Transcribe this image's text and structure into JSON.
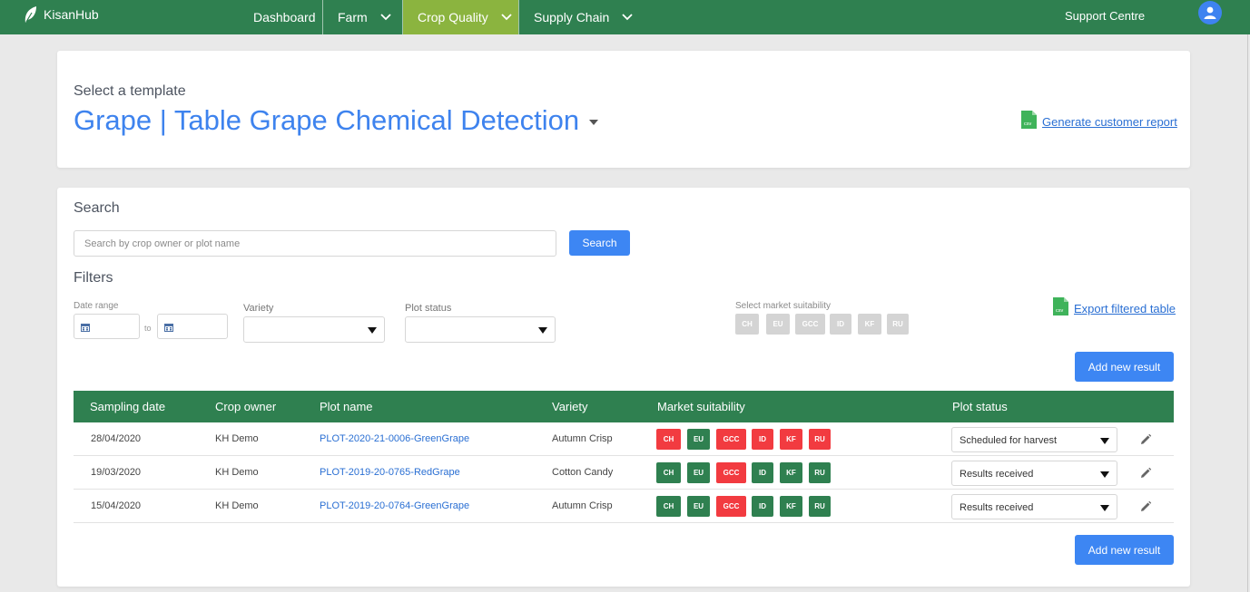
{
  "app": {
    "brand": "KisanHub",
    "nav": [
      {
        "label": "Dashboard",
        "has_menu": false,
        "active": false
      },
      {
        "label": "Farm",
        "has_menu": true,
        "active": false
      },
      {
        "label": "Crop Quality",
        "has_menu": true,
        "active": true
      },
      {
        "label": "Supply Chain",
        "has_menu": true,
        "active": false
      }
    ],
    "support_label": "Support Centre",
    "avatar_icon": "user-icon"
  },
  "template": {
    "label": "Select a template",
    "selected": "Grape | Table Grape Chemical Detection",
    "report_link": "Generate customer report",
    "report_icon": "csv-file-icon",
    "csv_badge": "csv"
  },
  "search": {
    "heading": "Search",
    "placeholder": "Search by crop owner or plot name",
    "value": "",
    "button": "Search"
  },
  "filters": {
    "heading": "Filters",
    "date_range_label": "Date range",
    "to_label": "to",
    "date_from": "",
    "date_to": "",
    "variety_label": "Variety",
    "variety_value": "",
    "plot_status_label": "Plot status",
    "plot_status_value": "",
    "market_label": "Select market suitability",
    "markets": [
      "CH",
      "EU",
      "GCC",
      "ID",
      "KF",
      "RU"
    ],
    "export_link": "Export filtered table",
    "add_result": "Add new result"
  },
  "colors": {
    "brand_green": "#2f8050",
    "active_nav": "#8bb43f",
    "accent_blue": "#3d86f3",
    "suitable": "#2f8050",
    "unsuitable": "#f23b40",
    "chip_inactive": "#d4d4d4"
  },
  "table": {
    "headers": [
      "Sampling date",
      "Crop owner",
      "Plot name",
      "Variety",
      "Market suitability",
      "Plot status"
    ],
    "rows": [
      {
        "date": "28/04/2020",
        "owner": "KH Demo",
        "plot": "PLOT-2020-21-0006-GreenGrape",
        "variety": "Autumn Crisp",
        "markets": [
          {
            "code": "CH",
            "ok": false
          },
          {
            "code": "EU",
            "ok": true
          },
          {
            "code": "GCC",
            "ok": false
          },
          {
            "code": "ID",
            "ok": false
          },
          {
            "code": "KF",
            "ok": false
          },
          {
            "code": "RU",
            "ok": false
          }
        ],
        "status": "Scheduled for harvest"
      },
      {
        "date": "19/03/2020",
        "owner": "KH Demo",
        "plot": "PLOT-2019-20-0765-RedGrape",
        "variety": "Cotton Candy",
        "markets": [
          {
            "code": "CH",
            "ok": true
          },
          {
            "code": "EU",
            "ok": true
          },
          {
            "code": "GCC",
            "ok": false
          },
          {
            "code": "ID",
            "ok": true
          },
          {
            "code": "KF",
            "ok": true
          },
          {
            "code": "RU",
            "ok": true
          }
        ],
        "status": "Results received"
      },
      {
        "date": "15/04/2020",
        "owner": "KH Demo",
        "plot": "PLOT-2019-20-0764-GreenGrape",
        "variety": "Autumn Crisp",
        "markets": [
          {
            "code": "CH",
            "ok": true
          },
          {
            "code": "EU",
            "ok": true
          },
          {
            "code": "GCC",
            "ok": false
          },
          {
            "code": "ID",
            "ok": true
          },
          {
            "code": "KF",
            "ok": true
          },
          {
            "code": "RU",
            "ok": true
          }
        ],
        "status": "Results received"
      }
    ]
  }
}
